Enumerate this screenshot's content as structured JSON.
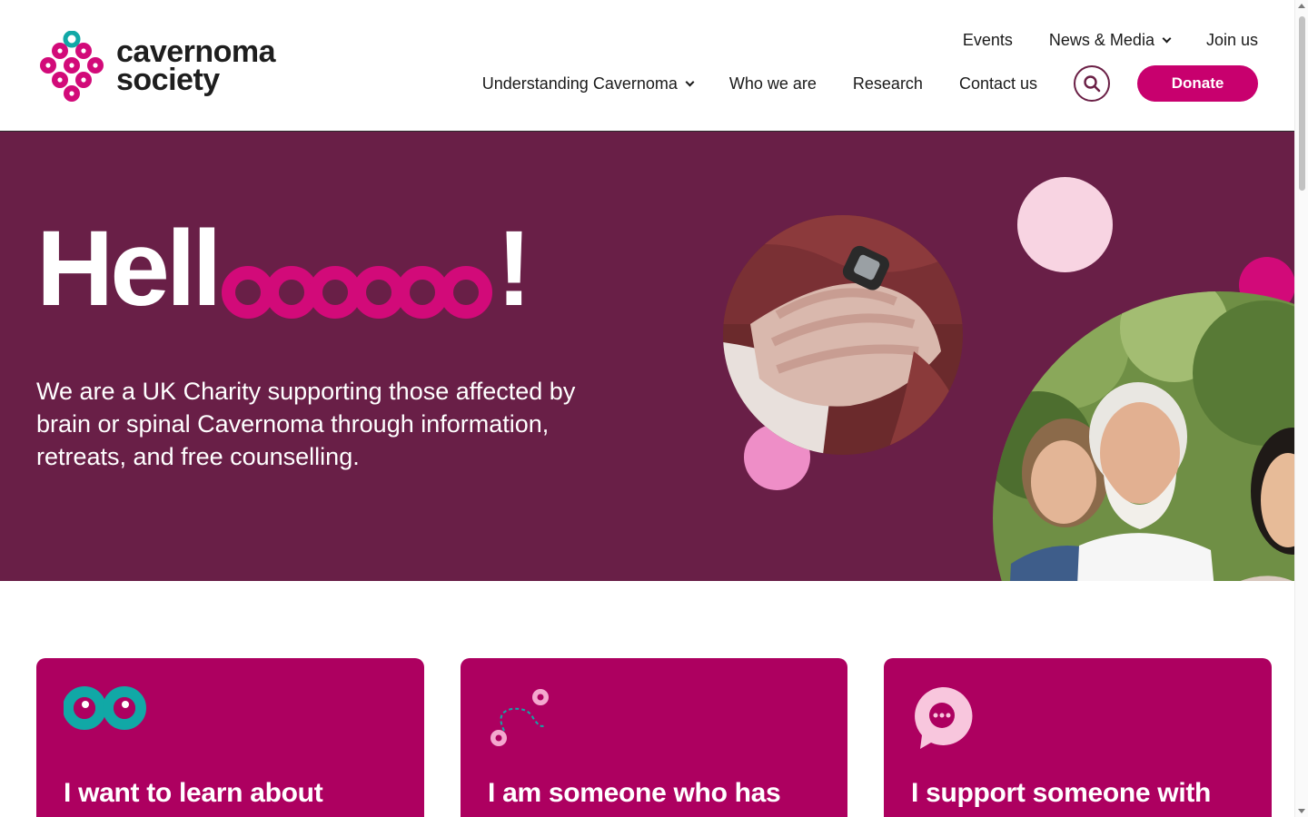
{
  "brand": {
    "line1": "cavernoma",
    "line2": "society",
    "colors": {
      "plum": "#691f47",
      "magenta": "#c8006e",
      "card": "#ad0060",
      "teal": "#11a8a6",
      "pink_light": "#f8d4e2",
      "pink_mid": "#ee8ec7"
    }
  },
  "topnav": {
    "events": "Events",
    "news_media": "News & Media",
    "join": "Join us"
  },
  "mainnav": {
    "understanding": "Understanding Cavernoma",
    "who": "Who we are",
    "research": "Research",
    "contact": "Contact us",
    "search_icon": "search-icon",
    "donate": "Donate"
  },
  "hero": {
    "hello_prefix": "Hell",
    "hello_suffix": "!",
    "description": "We are a UK Charity supporting those affected by brain or spinal Cavernoma through information, retreats, and free counselling."
  },
  "cards": [
    {
      "title": "I want to learn about",
      "icon": "eyes-icon"
    },
    {
      "title": "I am someone who has",
      "icon": "path-dots-icon"
    },
    {
      "title": "I support someone with",
      "icon": "speech-bubble-icon"
    }
  ]
}
